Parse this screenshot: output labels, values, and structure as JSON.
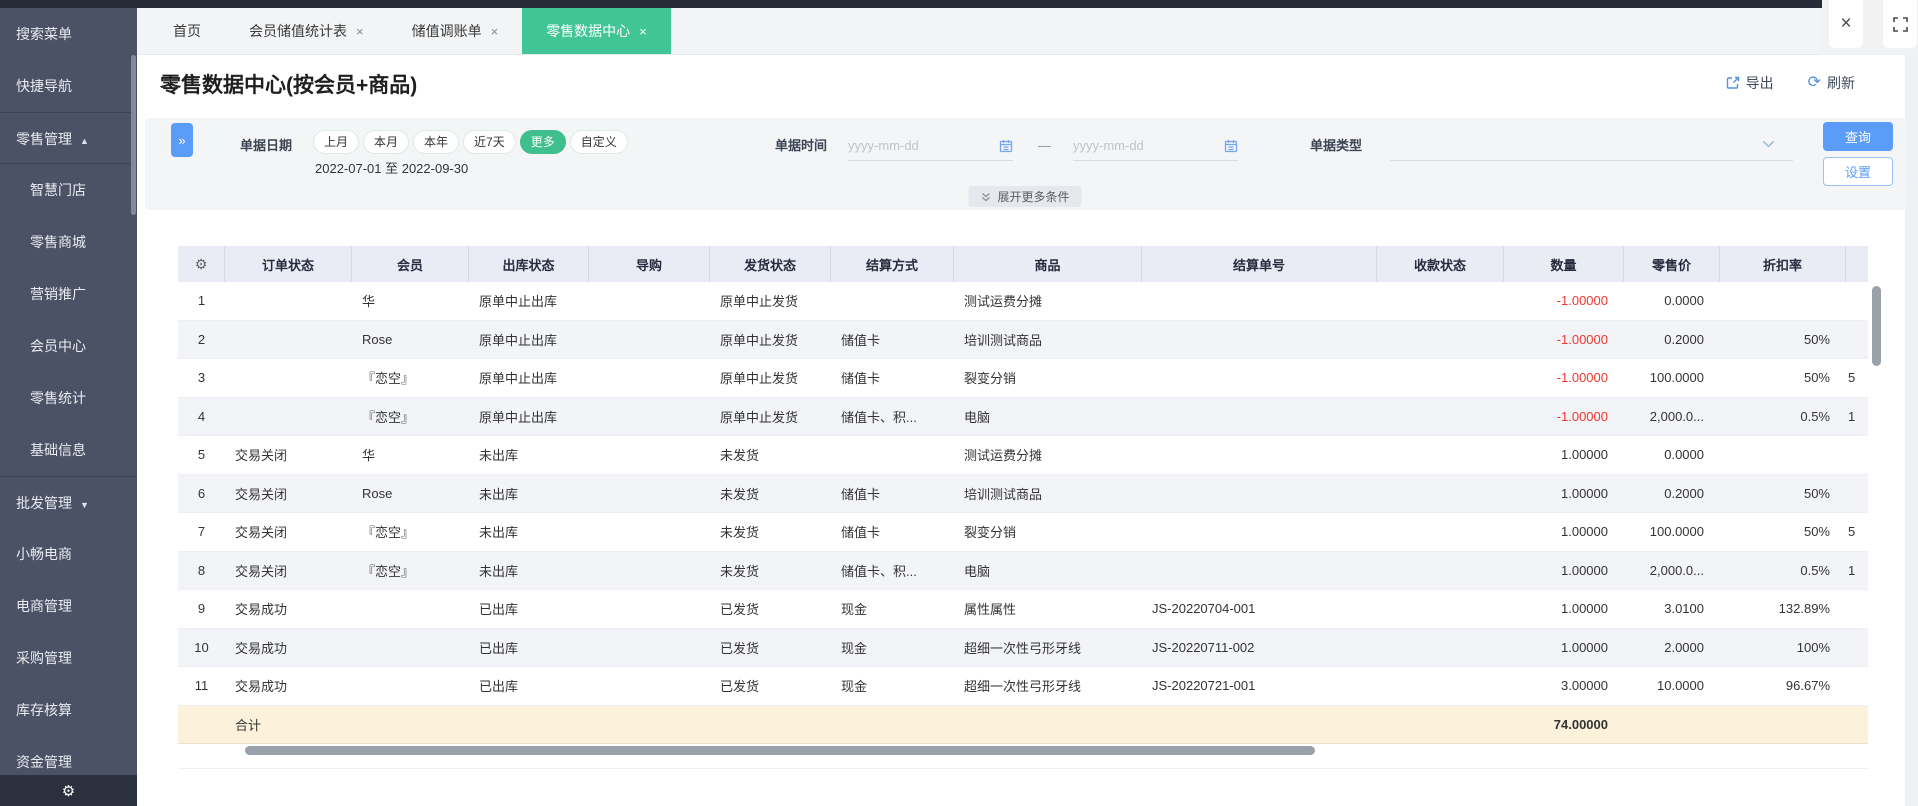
{
  "window": {
    "close": "×"
  },
  "sidebar": {
    "items": [
      {
        "label": "搜索菜单",
        "type": "top"
      },
      {
        "label": "快捷导航",
        "type": "top"
      },
      {
        "label": "零售管理",
        "type": "group",
        "arrow": "up",
        "divider_top": true,
        "divider_bottom": true
      },
      {
        "label": "智慧门店",
        "type": "sub"
      },
      {
        "label": "零售商城",
        "type": "sub"
      },
      {
        "label": "营销推广",
        "type": "sub"
      },
      {
        "label": "会员中心",
        "type": "sub"
      },
      {
        "label": "零售统计",
        "type": "sub"
      },
      {
        "label": "基础信息",
        "type": "sub"
      },
      {
        "label": "批发管理",
        "type": "group",
        "arrow": "down",
        "divider_top": true
      },
      {
        "label": "小畅电商",
        "type": "top"
      },
      {
        "label": "电商管理",
        "type": "top"
      },
      {
        "label": "采购管理",
        "type": "top"
      },
      {
        "label": "库存核算",
        "type": "top"
      },
      {
        "label": "资金管理",
        "type": "top"
      }
    ]
  },
  "tabs": [
    {
      "label": "首页",
      "closable": false,
      "active": false
    },
    {
      "label": "会员储值统计表",
      "closable": true,
      "active": false
    },
    {
      "label": "储值调账单",
      "closable": true,
      "active": false
    },
    {
      "label": "零售数据中心",
      "closable": true,
      "active": true
    }
  ],
  "page": {
    "title": "零售数据中心(按会员+商品)",
    "export_label": "导出",
    "refresh_label": "刷新"
  },
  "filters": {
    "doc_date_label": "单据日期",
    "quick_ranges": [
      "上月",
      "本月",
      "本年",
      "近7天"
    ],
    "more_label": "更多",
    "custom_label": "自定义",
    "date_range": "2022-07-01 至 2022-09-30",
    "doc_time_label": "单据时间",
    "date_placeholder": "yyyy-mm-dd",
    "range_separator": "—",
    "doc_type_label": "单据类型",
    "query_label": "查询",
    "settings_label": "设置",
    "expand_label": "展开更多条件"
  },
  "table": {
    "columns": [
      "订单状态",
      "会员",
      "出库状态",
      "导购",
      "发货状态",
      "结算方式",
      "商品",
      "结算单号",
      "收款状态",
      "数量",
      "零售价",
      "折扣率"
    ],
    "rows": [
      [
        "1",
        "",
        "华",
        "原单中止出库",
        "",
        "原单中止发货",
        "",
        "测试运费分摊",
        "",
        "",
        "-1.00000",
        "0.0000",
        "",
        ""
      ],
      [
        "2",
        "",
        "Rose",
        "原单中止出库",
        "",
        "原单中止发货",
        "储值卡",
        "培训测试商品",
        "",
        "",
        "-1.00000",
        "0.2000",
        "50%",
        ""
      ],
      [
        "3",
        "",
        "『恋空』",
        "原单中止出库",
        "",
        "原单中止发货",
        "储值卡",
        "裂变分销",
        "",
        "",
        "-1.00000",
        "100.0000",
        "50%",
        "5"
      ],
      [
        "4",
        "",
        "『恋空』",
        "原单中止出库",
        "",
        "原单中止发货",
        "储值卡、积...",
        "电脑",
        "",
        "",
        "-1.00000",
        "2,000.0...",
        "0.5%",
        "1"
      ],
      [
        "5",
        "交易关闭",
        "华",
        "未出库",
        "",
        "未发货",
        "",
        "测试运费分摊",
        "",
        "",
        "1.00000",
        "0.0000",
        "",
        ""
      ],
      [
        "6",
        "交易关闭",
        "Rose",
        "未出库",
        "",
        "未发货",
        "储值卡",
        "培训测试商品",
        "",
        "",
        "1.00000",
        "0.2000",
        "50%",
        ""
      ],
      [
        "7",
        "交易关闭",
        "『恋空』",
        "未出库",
        "",
        "未发货",
        "储值卡",
        "裂变分销",
        "",
        "",
        "1.00000",
        "100.0000",
        "50%",
        "5"
      ],
      [
        "8",
        "交易关闭",
        "『恋空』",
        "未出库",
        "",
        "未发货",
        "储值卡、积...",
        "电脑",
        "",
        "",
        "1.00000",
        "2,000.0...",
        "0.5%",
        "1"
      ],
      [
        "9",
        "交易成功",
        "",
        "已出库",
        "",
        "已发货",
        "现金",
        "属性属性",
        "JS-20220704-001",
        "",
        "1.00000",
        "3.0100",
        "132.89%",
        ""
      ],
      [
        "10",
        "交易成功",
        "",
        "已出库",
        "",
        "已发货",
        "现金",
        "超细一次性弓形牙线",
        "JS-20220711-002",
        "",
        "1.00000",
        "2.0000",
        "100%",
        ""
      ],
      [
        "11",
        "交易成功",
        "",
        "已出库",
        "",
        "已发货",
        "现金",
        "超细一次性弓形牙线",
        "JS-20220721-001",
        "",
        "3.00000",
        "10.0000",
        "96.67%",
        ""
      ]
    ],
    "total": {
      "label": "合计",
      "quantity": "74.00000"
    }
  }
}
